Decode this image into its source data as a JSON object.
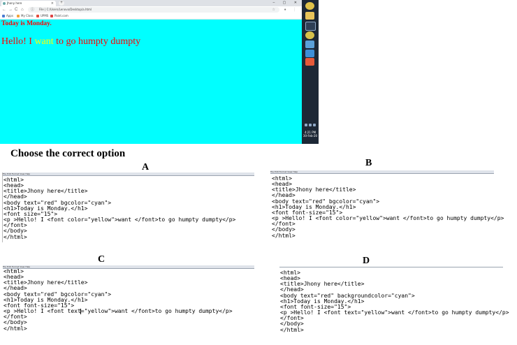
{
  "browser": {
    "tab_title": "Jhony here",
    "tab_close": "×",
    "new_tab": "+",
    "window_controls": "– ▢ ✕",
    "nav_back": "←",
    "nav_forward": "→",
    "nav_reload": "C",
    "nav_home": "⌂",
    "address_icon": "ⓘ",
    "address": "File | C:/Users/Lenovo/Desktop/a.html",
    "star": "☆",
    "toolbar_right": "● ⋮",
    "bookmarks": [
      {
        "label": "Apps",
        "color": "#4a7bd0"
      },
      {
        "label": "My Class",
        "color": "#f2a33a"
      },
      {
        "label": "UPMS",
        "color": "#e24b3b"
      },
      {
        "label": "Paint.com",
        "color": "#d44"
      }
    ],
    "taskbar_icons": [
      {
        "name": "chrome",
        "color": "#e0c24a"
      },
      {
        "name": "folder",
        "color": "#e8c45a"
      },
      {
        "name": "speedometer",
        "color": "#2e3f55"
      },
      {
        "name": "chrome-2",
        "color": "#d6c04a"
      },
      {
        "name": "people",
        "color": "#5aa0d8"
      },
      {
        "name": "windows",
        "color": "#3d8fd8"
      },
      {
        "name": "paint",
        "color": "#e55a3a"
      }
    ],
    "clock_time": "4:21 PM",
    "clock_date": "30-Feb-20"
  },
  "page": {
    "heading": "Today is Monday.",
    "para_before": "Hello! I ",
    "para_highlight": "want",
    "para_after": " to go humpty dumpty",
    "heading_color": "#ff0000",
    "background_color": "#00ffff",
    "highlight_color": "#ffff00"
  },
  "question": "Choose the correct option",
  "options": {
    "A": {
      "letter": "A",
      "menu": "File  Edit  Format  View  Help",
      "code": "<html>\n<head>\n<title>Jhony here</title>\n</head>\n<body text=\"red\" bgcolor=\"cyan\">\n<h1>Today is Monday.</h1>\n<font size=\"15\">\n<p >Hello! I <font color=\"yellow\">want </font>to go humpty dumpty</p>\n</font>\n</body>\n</html>"
    },
    "B": {
      "letter": "B",
      "menu": "File  Edit  Format  View  Help",
      "code": "<html>\n<head>\n<title>Jhony here</title>\n</head>\n<body text=\"red\" bgcolor=\"cyan\">\n<h1>Today is Monday.</h1>\n<font font-size=\"15\">\n<p >Hello! I <font color=\"yellow\">want </font>to go humpty dumpty</p>\n</font>\n</body>\n</html>"
    },
    "C": {
      "letter": "C",
      "menu": "File  Edit  Format  View  Help",
      "code_before_cursor": "<html>\n<head>\n<title>Jhony here</title>\n</head>\n<body text=\"red\" bgcolor=\"cyan\">\n<h1>Today is Monday.</h1>\n<font font-size=\"15\">\n<p >Hello! I <font text",
      "code_after_cursor": "=\"yellow\">want </font>to go humpty dumpty</p>\n</font>\n</body>\n</html>"
    },
    "D": {
      "letter": "D",
      "menu": "",
      "code": "<html>\n<head>\n<title>Jhony here</title>\n</head>\n<body text=\"red\" backgroundcolor=\"cyan\">\n<h1>Today is Monday.</h1>\n<font font-size=\"15\">\n<p >Hello! I <font text=\"yellow\">want </font>to go humpty dumpty</p>\n</font>\n</body>\n</html>"
    }
  }
}
